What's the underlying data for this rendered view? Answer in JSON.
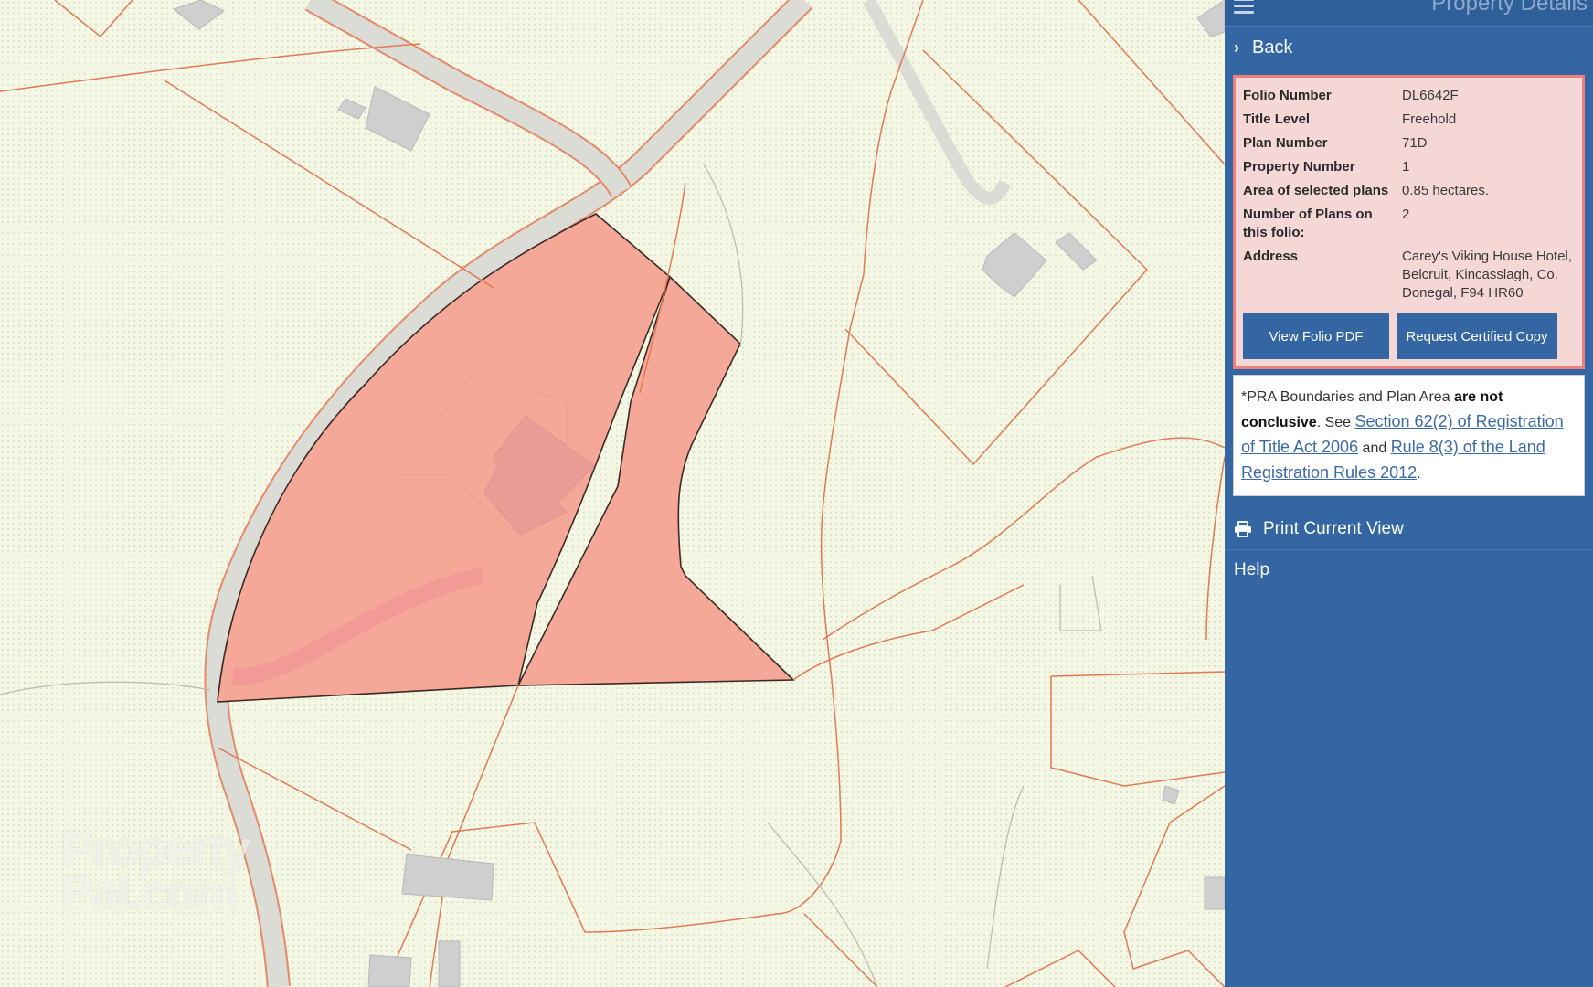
{
  "panel": {
    "title": "Property Details",
    "back_label": "Back",
    "folio": {
      "rows": [
        {
          "label": "Folio Number",
          "value": "DL6642F"
        },
        {
          "label": "Title Level",
          "value": "Freehold"
        },
        {
          "label": "Plan Number",
          "value": "71D"
        },
        {
          "label": "Property Number",
          "value": "1"
        },
        {
          "label": "Area of selected plans",
          "value": "0.85 hectares."
        },
        {
          "label": "Number of Plans on this folio:",
          "value": "2"
        },
        {
          "label": "Address",
          "value": "Carey's Viking House Hotel, Belcruit, Kincasslagh, Co. Donegal, F94 HR60"
        }
      ],
      "view_pdf_label": "View Folio PDF",
      "request_copy_label": "Request Certified Copy"
    },
    "notice": {
      "prefix": "*PRA Boundaries and Plan Area ",
      "bold": "are not conclusive",
      "mid1": ". See ",
      "link1": "Section 62(2) of Registration of Title Act 2006",
      "mid2": " and ",
      "link2": "Rule 8(3) of the Land Registration Rules 2012",
      "suffix": "."
    },
    "print_label": "Print Current View",
    "help_label": "Help"
  },
  "map": {
    "watermark_line1": "Property",
    "watermark_line2": "Pal.com",
    "colors": {
      "background": "#f3f7e3",
      "parcel_fill": "#f5a898",
      "boundary_line": "#e07a55",
      "road": "#d9d9d4",
      "building": "#cfcfcf",
      "selection_outline": "#3a2a25"
    }
  },
  "colors": {
    "panel_bg": "#3366a3",
    "folio_box_bg": "#f5d7d6",
    "folio_box_border": "#ee7f7b"
  }
}
